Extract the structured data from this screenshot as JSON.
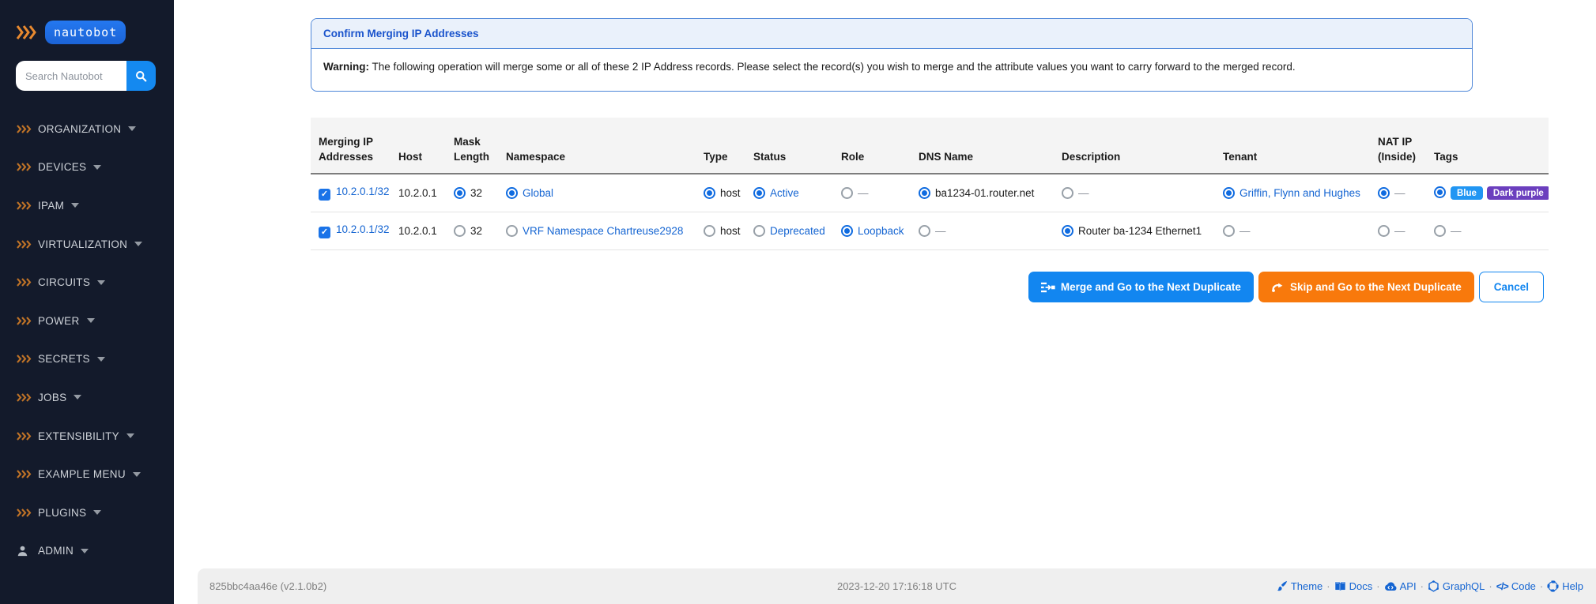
{
  "sidebar": {
    "logo_text": "nautobot",
    "search": {
      "placeholder": "Search Nautobot",
      "button_icon": "search-icon"
    },
    "items": [
      {
        "label": "ORGANIZATION",
        "icon": "triple-chevron-icon"
      },
      {
        "label": "DEVICES",
        "icon": "triple-chevron-icon"
      },
      {
        "label": "IPAM",
        "icon": "triple-chevron-icon"
      },
      {
        "label": "VIRTUALIZATION",
        "icon": "triple-chevron-icon"
      },
      {
        "label": "CIRCUITS",
        "icon": "triple-chevron-icon"
      },
      {
        "label": "POWER",
        "icon": "triple-chevron-icon"
      },
      {
        "label": "SECRETS",
        "icon": "triple-chevron-icon"
      },
      {
        "label": "JOBS",
        "icon": "triple-chevron-icon"
      },
      {
        "label": "EXTENSIBILITY",
        "icon": "triple-chevron-icon"
      },
      {
        "label": "EXAMPLE MENU",
        "icon": "triple-chevron-icon"
      },
      {
        "label": "PLUGINS",
        "icon": "triple-chevron-icon"
      },
      {
        "label": "ADMIN",
        "icon": "user-icon"
      }
    ]
  },
  "panel": {
    "title": "Confirm Merging IP Addresses",
    "warning_bold": "Warning:",
    "warning_text": " The following operation will merge some or all of these 2 IP Address records. Please select the record(s) you wish to merge and the attribute values you want to carry forward to the merged record."
  },
  "table": {
    "headers": [
      "Merging IP Addresses",
      "Host",
      "Mask Length",
      "Namespace",
      "Type",
      "Status",
      "Role",
      "DNS Name",
      "Description",
      "Tenant",
      "NAT IP (Inside)",
      "Tags"
    ],
    "rows": [
      {
        "checked": true,
        "ip": "10.2.0.1/32",
        "host": "10.2.0.1",
        "cells": [
          {
            "name": "mask-length",
            "selected": true,
            "label": "32",
            "style": "text"
          },
          {
            "name": "namespace",
            "selected": true,
            "label": "Global",
            "style": "link"
          },
          {
            "name": "type",
            "selected": true,
            "label": "host",
            "style": "text"
          },
          {
            "name": "status",
            "selected": true,
            "label": "Active",
            "style": "link"
          },
          {
            "name": "role",
            "selected": false,
            "label": "—",
            "style": "dash"
          },
          {
            "name": "dns-name",
            "selected": true,
            "label": "ba1234-01.router.net",
            "style": "text"
          },
          {
            "name": "description",
            "selected": false,
            "label": "—",
            "style": "dash"
          },
          {
            "name": "tenant",
            "selected": true,
            "label": "Griffin, Flynn and Hughes",
            "style": "link"
          },
          {
            "name": "nat-ip",
            "selected": true,
            "label": "—",
            "style": "dash"
          },
          {
            "name": "tags",
            "selected": true,
            "tags": [
              {
                "label": "Blue",
                "color": "#2196f3"
              },
              {
                "label": "Dark purple",
                "color": "#6b3fbe"
              }
            ]
          }
        ]
      },
      {
        "checked": true,
        "ip": "10.2.0.1/32",
        "host": "10.2.0.1",
        "cells": [
          {
            "name": "mask-length",
            "selected": false,
            "label": "32",
            "style": "text"
          },
          {
            "name": "namespace",
            "selected": false,
            "label": "VRF Namespace Chartreuse2928",
            "style": "link"
          },
          {
            "name": "type",
            "selected": false,
            "label": "host",
            "style": "text"
          },
          {
            "name": "status",
            "selected": false,
            "label": "Deprecated",
            "style": "link"
          },
          {
            "name": "role",
            "selected": true,
            "label": "Loopback",
            "style": "link"
          },
          {
            "name": "dns-name",
            "selected": false,
            "label": "—",
            "style": "dash"
          },
          {
            "name": "description",
            "selected": true,
            "label": "Router ba-1234 Ethernet1",
            "style": "text"
          },
          {
            "name": "tenant",
            "selected": false,
            "label": "—",
            "style": "dash"
          },
          {
            "name": "nat-ip",
            "selected": false,
            "label": "—",
            "style": "dash"
          },
          {
            "name": "tags",
            "selected": false,
            "label": "—",
            "style": "dash"
          }
        ]
      }
    ]
  },
  "actions": {
    "merge_label": "Merge and Go to the Next Duplicate",
    "skip_label": "Skip and Go to the Next Duplicate",
    "cancel_label": "Cancel"
  },
  "footer": {
    "version": "825bbc4aa46e (v2.1.0b2)",
    "timestamp": "2023-12-20 17:16:18 UTC",
    "links": [
      {
        "label": "Theme",
        "icon": "theme-icon"
      },
      {
        "label": "Docs",
        "icon": "docs-icon"
      },
      {
        "label": "API",
        "icon": "api-icon"
      },
      {
        "label": "GraphQL",
        "icon": "graphql-icon"
      },
      {
        "label": "Code",
        "icon": "code-icon"
      },
      {
        "label": "Help",
        "icon": "help-icon"
      }
    ]
  },
  "colors": {
    "accent_blue": "#1286f0",
    "accent_orange": "#f8790c",
    "link_blue": "#1565d2",
    "sidebar_bg": "#131a2b",
    "panel_border": "#4d86d8",
    "panel_title": "#1a53cc"
  }
}
